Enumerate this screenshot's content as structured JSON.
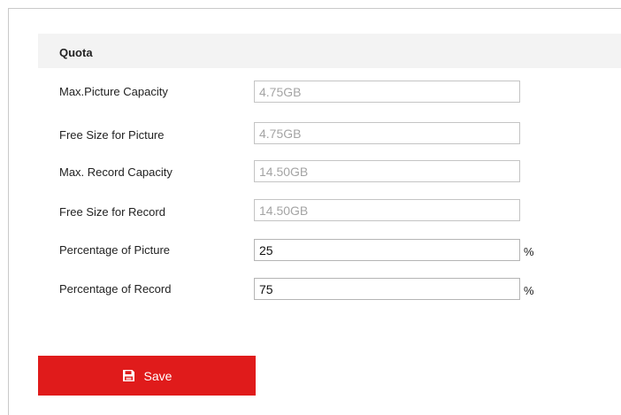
{
  "quota": {
    "title": "Quota",
    "rows": [
      {
        "label": "Max.Picture Capacity",
        "value": "4.75GB",
        "unit": ""
      },
      {
        "label": "Free Size for Picture",
        "value": "4.75GB",
        "unit": ""
      },
      {
        "label": "Max. Record Capacity",
        "value": "14.50GB",
        "unit": ""
      },
      {
        "label": "Free Size for Record",
        "value": "14.50GB",
        "unit": ""
      },
      {
        "label": "Percentage of Picture",
        "value": "25",
        "unit": "%"
      },
      {
        "label": "Percentage of Record",
        "value": "75",
        "unit": "%"
      }
    ]
  },
  "actions": {
    "save_label": "Save",
    "save_icon": "floppy-disk-icon",
    "accent_color": "#e01b1b"
  }
}
